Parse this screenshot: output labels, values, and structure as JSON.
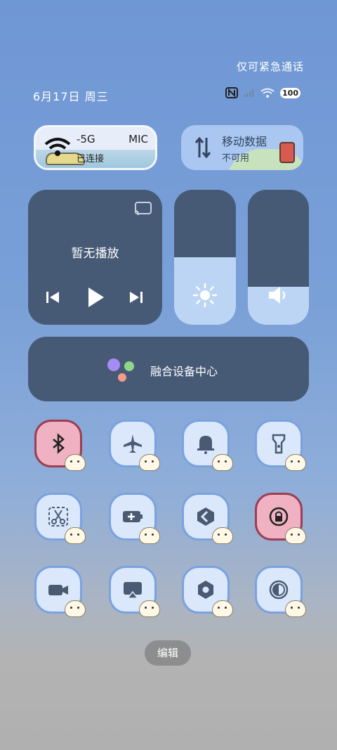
{
  "header": {
    "emergency_text": "仅可紧急通话",
    "date_text": "6月17日 周三",
    "battery_text": "100",
    "icons": [
      "nfc-icon",
      "signal-icon",
      "wifi-icon",
      "battery-icon"
    ]
  },
  "wifi_tile": {
    "ssid": "-5G",
    "suffix": "MIC",
    "status": "已连接"
  },
  "mobile_tile": {
    "title": "移动数据",
    "status": "不可用"
  },
  "media": {
    "title": "暂无播放"
  },
  "sliders": {
    "brightness_level": 0.5,
    "volume_level": 0.28
  },
  "hub": {
    "label": "融合设备中心"
  },
  "toggles": [
    {
      "name": "bluetooth",
      "active": true
    },
    {
      "name": "airplane-mode",
      "active": false
    },
    {
      "name": "notification-bell",
      "active": false
    },
    {
      "name": "flashlight",
      "active": false
    },
    {
      "name": "screenshot",
      "active": false
    },
    {
      "name": "battery-saver",
      "active": false
    },
    {
      "name": "link",
      "active": false
    },
    {
      "name": "rotation-lock",
      "active": true
    },
    {
      "name": "screen-record",
      "active": false
    },
    {
      "name": "cast",
      "active": false
    },
    {
      "name": "settings",
      "active": false
    },
    {
      "name": "dark-mode",
      "active": false
    }
  ],
  "footer": {
    "edit_label": "编辑"
  },
  "colors": {
    "panel": "#465a76",
    "slider_fill": "#bcd5f5",
    "active_toggle": "#f0b1c2"
  }
}
